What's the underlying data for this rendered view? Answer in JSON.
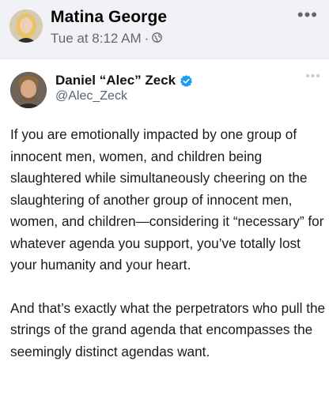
{
  "post": {
    "author_name": "Matina George",
    "timestamp": "Tue at 8:12 AM",
    "separator": "·",
    "audience_icon": "public-globe-icon",
    "more_icon": "more-horizontal-icon"
  },
  "tweet": {
    "display_name": "Daniel “Alec” Zeck",
    "handle": "@Alec_Zeck",
    "verified": true,
    "paragraphs": [
      "If you are emotionally impacted by one group of innocent men, women, and children being slaughtered while simultaneously cheering on the slaughtering of another group of innocent men, women, and children—considering it “necessary” for whatever agenda you support, you’ve totally lost your humanity and your heart.",
      "And that’s exactly what the perpetrators who pull the strings of the grand agenda that encompasses the seemingly distinct agendas want."
    ]
  },
  "colors": {
    "page_background": "#f0f2f5",
    "card_background": "#ffffff",
    "verified_blue": "#1d9bf0",
    "name_text": "#050505",
    "meta_text": "#65676b"
  }
}
